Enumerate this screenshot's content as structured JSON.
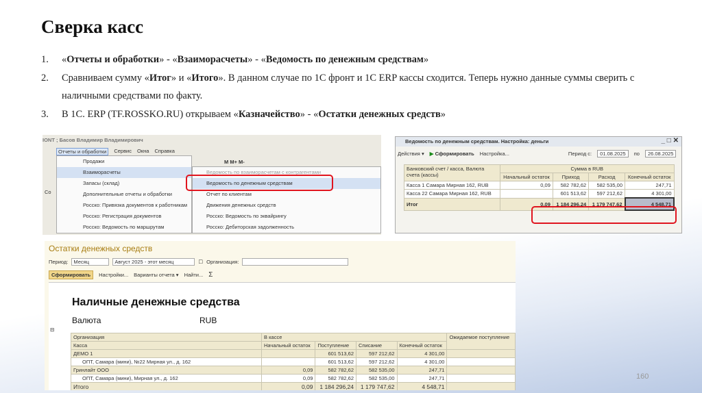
{
  "slide": {
    "title": "Сверка касс",
    "page_number": "160",
    "items": [
      {
        "num": "1.",
        "parts": [
          "«",
          "Отчеты и обработки",
          "» - «",
          "Взаиморасчеты",
          "» - «",
          "Ведомость по денежным средствам",
          "»"
        ]
      },
      {
        "num": "2.",
        "text_a": "Сравниваем сумму «",
        "b1": "Итог",
        "text_b": "» и «",
        "b2": "Итого",
        "text_c": "». В данном случае по 1С фронт и 1С ERP кассы сходится. Теперь нужно данные суммы сверить с наличными средствами по факту."
      },
      {
        "num": "3.",
        "text_a": "В 1С. ERP (TF.ROSSKO.RU) открываем «",
        "b1": "Казначейство",
        "text_b": "» - «",
        "b2": "Остатки денежных средств",
        "text_c": "»"
      }
    ]
  },
  "shot1": {
    "window_title": "IONT ; Басов Владимир Владимирович",
    "menubar": [
      "Отчеты и обработки",
      "Сервис",
      "Окна",
      "Справка"
    ],
    "menu": [
      "Продажи",
      "Взаиморасчеты",
      "Запасы (склад)",
      "Дополнительные отчеты и обработки",
      "Росско: Привязка документов к работникам",
      "Росско: Регистрация документов",
      "Росско: Ведомость по маршрутам"
    ],
    "submenu": [
      "Ведомость по взаиморасчетам с контрагентами",
      "Ведомость по денежным средствам",
      "Отчет по клиентам",
      "Движения денежных средств",
      "Росско: Ведомость по эквайрингу",
      "Росско: Дебиторская задолженность"
    ],
    "toolbar": "M  M+  M-",
    "side_label": "Co"
  },
  "shot2": {
    "window_title": "Ведомость по денежным средствам. Настройка: деньги",
    "actions": "Действия ▾",
    "generate": "Сформировать",
    "settings": "Настройка...",
    "period_from_label": "Период с:",
    "period_from": "01.08.2025",
    "period_to_label": "по",
    "period_to": "26.08.2025",
    "headers": {
      "account": "Банковский счет / касса, Валюта счета (кассы)",
      "sum": "Сумма в RUB",
      "cols": [
        "Начальный остаток",
        "Приход",
        "Расход",
        "Конечный остаток"
      ]
    },
    "rows": [
      [
        "Касса 1 Самара Мирная 162, RUB",
        "0,09",
        "582 782,62",
        "582 535,00",
        "247,71"
      ],
      [
        "Касса 22 Самара Мирная 162, RUB",
        "",
        "601 513,62",
        "597 212,62",
        "4 301,00"
      ]
    ],
    "total": [
      "Итог",
      "0,09",
      "1 184 296,24",
      "1 179 747,62",
      "4 548,71"
    ]
  },
  "shot3": {
    "window_title": "Остатки денежных средств",
    "period_label": "Период:",
    "period_value": "Месяц",
    "period_range": "Август 2025 - этот месяц",
    "org_label": "Организация:",
    "toolbar": {
      "generate": "Сформировать",
      "settings": "Настройки...",
      "variants": "Варианты отчета ▾",
      "find": "Найти..."
    },
    "report_title": "Наличные денежные средства",
    "currency_label": "Валюта",
    "currency_value": "RUB",
    "headers": {
      "org": "Организация",
      "cash": "Касса",
      "in_cash": "В кассе",
      "cols": [
        "Начальный остаток",
        "Поступление",
        "Списание",
        "Конечный остаток"
      ],
      "expected": "Ожидаемое поступление"
    },
    "rows": [
      [
        "ДЕМО 1",
        "",
        "601 513,62",
        "597 212,62",
        "4 301,00"
      ],
      [
        "ОПТ, Самара (мини), №22 Мирная ул., д. 162",
        "",
        "601 513,62",
        "597 212,62",
        "4 301,00"
      ],
      [
        "Гринлайт ООО",
        "0,09",
        "582 782,62",
        "582 535,00",
        "247,71"
      ],
      [
        "ОПТ, Самара (мини), Мирная ул., д. 162",
        "0,09",
        "582 782,62",
        "582 535,00",
        "247,71"
      ]
    ],
    "total": [
      "Итого",
      "0,09",
      "1 184 296,24",
      "1 179 747,62",
      "4 548,71"
    ]
  }
}
